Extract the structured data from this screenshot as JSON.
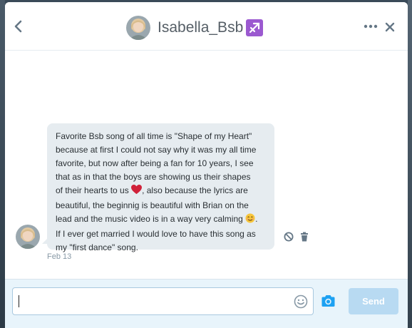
{
  "header": {
    "title": "Isabella_Bsb",
    "title_emoji": "sagittarius-icon",
    "back_icon": "chevron-left-icon",
    "more_icon": "more-dots-icon",
    "close_icon": "close-icon"
  },
  "conversation": {
    "messages": [
      {
        "lines": [
          "Favorite Bsb song of all time is \"Shape of my Heart\"",
          "because at first I could not say why it was my all time",
          "favorite, but now after being a fan for 10 years, I see",
          "that as in that the boys are showing us their shapes",
          "of their hearts to us",
          ", also because the lyrics are",
          "beautiful, the beginnig is beautiful with Brian on the",
          "lead and the music video is in a way very calming",
          ".",
          "If I ever get married I would love to have this song as",
          "my \"first dance\" song."
        ],
        "inline_emojis": [
          "red-heart-icon",
          "smiling-face-icon"
        ],
        "time": "Feb 13"
      }
    ]
  },
  "composer": {
    "placeholder": "",
    "value": "",
    "send_label": "Send",
    "emoji_icon": "emoji-icon",
    "camera_icon": "camera-icon"
  },
  "colors": {
    "accent": "#1da1f2",
    "send_disabled": "#b8daf2",
    "bubble": "#e6ecf0",
    "zodiac": "#9b59d0"
  }
}
